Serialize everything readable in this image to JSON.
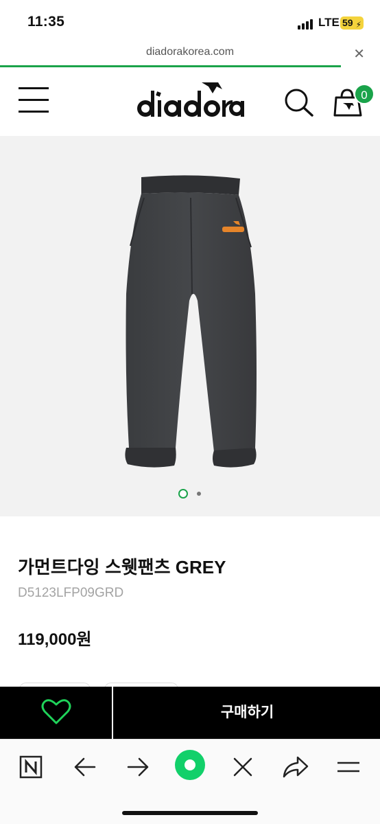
{
  "status_bar": {
    "time": "11:35",
    "network": "LTE",
    "battery": "59"
  },
  "browser": {
    "url": "diadorakorea.com",
    "load_progress_percent": 90,
    "close_icon": "close-icon"
  },
  "header": {
    "logo_text": "diadora",
    "cart_count": "0",
    "icons": [
      "menu-icon",
      "search-icon",
      "cart-icon"
    ]
  },
  "gallery": {
    "image_alt": "grey sweatpants",
    "slide_count": 2,
    "active_slide": 1
  },
  "product": {
    "name": "가먼트다잉 스웻팬츠 GREY",
    "code": "D5123LFP09GRD",
    "price": "119,000원"
  },
  "purchase_bar": {
    "buy_label": "구매하기",
    "wish_icon": "heart-icon",
    "accent_color": "#1aa34a"
  },
  "toolbar": {
    "icons": [
      "naver-icon",
      "back-arrow-icon",
      "forward-arrow-icon",
      "home-dot-icon",
      "close-icon",
      "share-icon",
      "menu-icon"
    ]
  }
}
